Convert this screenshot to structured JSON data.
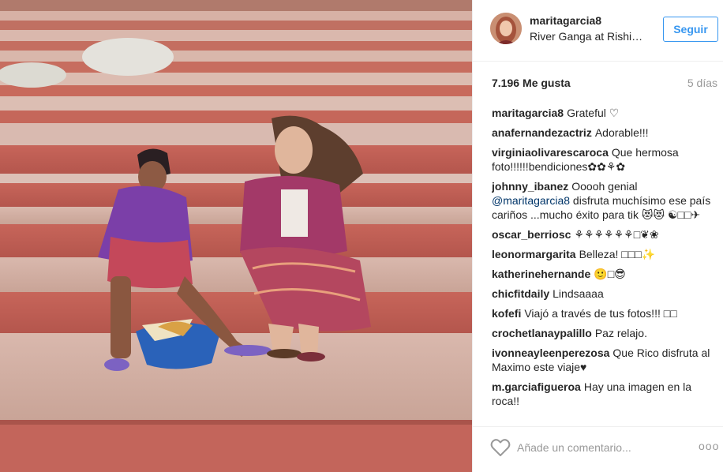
{
  "post": {
    "username": "maritagarcia8",
    "location": "River Ganga at Rishikesh",
    "follow_label": "Seguir",
    "likes_count": "7.196",
    "likes_label": "Me gusta",
    "age": "5 días"
  },
  "comments": [
    {
      "user": "maritagarcia8",
      "text": "Grateful ♡"
    },
    {
      "user": "anafernandezactriz",
      "text": "Adorable!!!"
    },
    {
      "user": "virginiaolivarescaroca",
      "text": "Que hermosa foto!!!!!!bendiciones✿✿⚘✿"
    },
    {
      "user": "johnny_ibanez",
      "text": "Ooooh genial",
      "mention": "@maritagarcia8",
      "text_after": "disfruta muchísimo ese país cariños ...mucho éxito para tik 😻😻 ☯︎□□✈"
    },
    {
      "user": "oscar_berriosc",
      "text": "⚘⚘⚘⚘⚘⚘□❦❀"
    },
    {
      "user": "leonormargarita",
      "text": "Belleza! □□□✨"
    },
    {
      "user": "katherinehernande",
      "text": "🙂□😎"
    },
    {
      "user": "chicfitdaily",
      "text": "Lindsaaaa"
    },
    {
      "user": "kofefi",
      "text": "Viajó a través de tus fotos!!! □□"
    },
    {
      "user": "crochetlanaypalillo",
      "text": "Paz relajo."
    },
    {
      "user": "ivonneayleenperezosa",
      "text": "Que Rico disfruta al Maximo este viaje♥"
    },
    {
      "user": "m.garciafigueroa",
      "text": "Hay una imagen en la roca!!"
    }
  ],
  "footer": {
    "comment_placeholder": "Añade un comentario...",
    "more_label": "ooo"
  },
  "icons": {
    "like": "heart-icon",
    "more": "more-options-icon"
  },
  "colors": {
    "accent": "#3897f0",
    "border": "#efefef",
    "muted": "#999999"
  }
}
